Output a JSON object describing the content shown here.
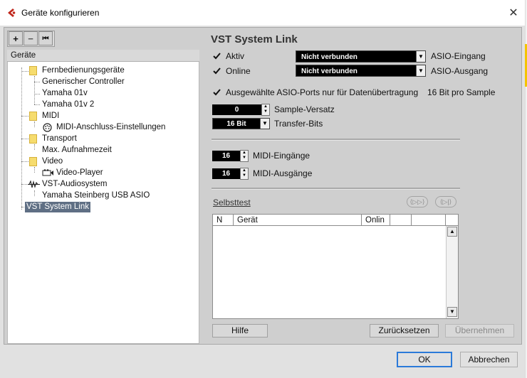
{
  "window": {
    "title": "Geräte konfigurieren",
    "close_glyph": "✕",
    "app_icon": "cubase-icon",
    "edge_accent_color": "#f4c400"
  },
  "toolbar": {
    "add_glyph": "+",
    "remove_glyph": "−",
    "reset_glyph": "⏮"
  },
  "tree": {
    "header": "Geräte",
    "items": [
      {
        "label": "Fernbedienungsgeräte",
        "icon": "folder-icon"
      },
      {
        "label": "Generischer Controller"
      },
      {
        "label": "Yamaha 01v"
      },
      {
        "label": "Yamaha 01v 2"
      },
      {
        "label": "MIDI",
        "icon": "folder-icon"
      },
      {
        "label": "MIDI-Anschluss-Einstellungen",
        "icon": "midi-port-icon"
      },
      {
        "label": "Transport",
        "icon": "folder-icon"
      },
      {
        "label": "Max. Aufnahmezeit"
      },
      {
        "label": "Video",
        "icon": "folder-icon"
      },
      {
        "label": "Video-Player",
        "icon": "video-player-icon"
      },
      {
        "label": "VST-Audiosystem",
        "icon": "audio-system-icon"
      },
      {
        "label": "Yamaha Steinberg USB ASIO"
      },
      {
        "label": "VST System Link",
        "selected": true
      }
    ]
  },
  "settings": {
    "section_title": "VST System Link",
    "aktiv_label": "Aktiv",
    "aktiv_checked": true,
    "online_label": "Online",
    "online_checked": true,
    "asio_input_value": "Nicht verbunden",
    "asio_input_label": "ASIO-Eingang",
    "asio_output_value": "Nicht verbunden",
    "asio_output_label": "ASIO-Ausgang",
    "asio_ports_label": "Ausgewählte ASIO-Ports nur für Datenübertragung",
    "asio_ports_checked": true,
    "bit_info": "16 Bit pro Sample",
    "sample_offset_value": "0",
    "sample_offset_label": "Sample-Versatz",
    "transfer_bits_value": "16 Bit",
    "transfer_bits_label": "Transfer-Bits",
    "midi_in_value": "16",
    "midi_in_label": "MIDI-Eingänge",
    "midi_out_value": "16",
    "midi_out_label": "MIDI-Ausgänge"
  },
  "selftest": {
    "label": "Selbsttest",
    "btn1_glyph": "⟨▷▷⟩",
    "btn2_glyph": "⟨▷|⟩"
  },
  "table": {
    "columns": [
      "N",
      "Gerät",
      "Onlin",
      "",
      ""
    ],
    "rows": []
  },
  "buttons": {
    "help": "Hilfe",
    "reset": "Zurücksetzen",
    "apply": "Übernehmen",
    "ok": "OK",
    "cancel": "Abbrechen"
  }
}
